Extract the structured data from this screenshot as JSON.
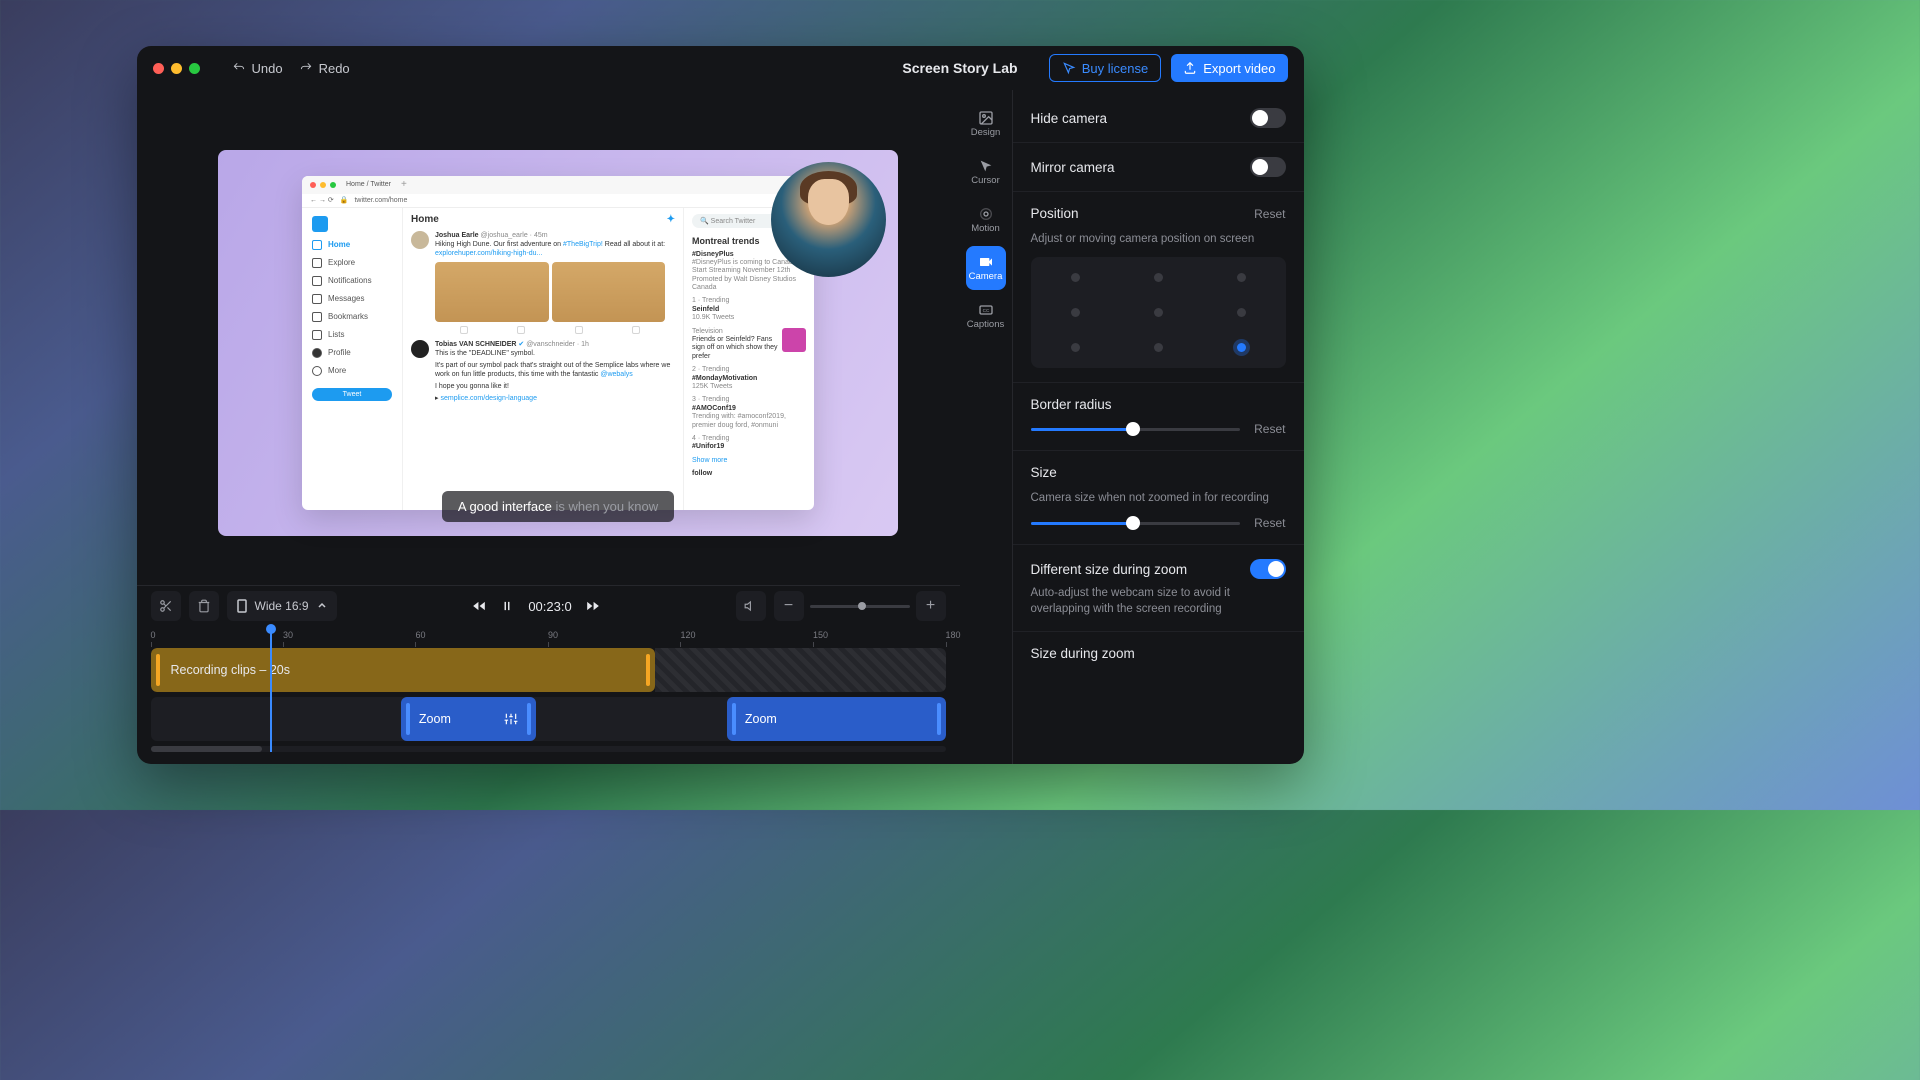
{
  "titlebar": {
    "undo": "Undo",
    "redo": "Redo",
    "title": "Screen Story Lab",
    "buy": "Buy license",
    "export": "Export video"
  },
  "stage": {
    "caption_strong": "A good interface",
    "caption_rest": " is when you know",
    "browser": {
      "tab": "Home / Twitter",
      "url": "twitter.com/home",
      "feed_title": "Home",
      "search": "Search Twitter",
      "nav": [
        "Home",
        "Explore",
        "Notifications",
        "Messages",
        "Bookmarks",
        "Lists",
        "Profile",
        "More"
      ],
      "tweet_btn": "Tweet",
      "tweet1": {
        "name": "Joshua Earle",
        "handle": "@joshua_earle · 45m",
        "text": "Hiking High Dune. Our first adventure on ",
        "hashtag": "#TheBigTrip!",
        "text2": " Read all about it at:",
        "link": "explorehuper.com/hiking-high-du..."
      },
      "tweet2": {
        "name": "Tobias VAN SCHNEIDER",
        "handle": " @vanschneider · 1h",
        "l1": "This is the \"DEADLINE\" symbol.",
        "l2": "It's part of our symbol pack that's straight out of the Semplice labs where we work on fun little products, this time with the fantastic ",
        "at": "@webalys",
        "l3": "I hope you gonna like it!",
        "link": "semplice.com/design-language"
      },
      "trends_title": "Montreal trends",
      "trends": [
        {
          "cat": "",
          "tag": "#DisneyPlus",
          "sub": "#DisneyPlus is coming to Canada. Start Streaming November 12th",
          "promo": "Promoted by Walt Disney Studios Canada"
        },
        {
          "cat": "1 · Trending",
          "tag": "Seinfeld",
          "sub": "10.9K Tweets"
        },
        {
          "cat": "Television",
          "tag": "Friends or Seinfeld? Fans sign off on which show they prefer"
        },
        {
          "cat": "2 · Trending",
          "tag": "#MondayMotivation",
          "sub": "125K Tweets"
        },
        {
          "cat": "3 · Trending",
          "tag": "#AMOConf19",
          "sub": "Trending with: #amoconf2019, premier doug ford, #onmuni"
        },
        {
          "cat": "4 · Trending",
          "tag": "#Unifor19"
        }
      ],
      "show_more": "Show more",
      "follow": "follow"
    }
  },
  "vtabs": [
    {
      "id": "design",
      "label": "Design"
    },
    {
      "id": "cursor",
      "label": "Cursor"
    },
    {
      "id": "motion",
      "label": "Motion"
    },
    {
      "id": "camera",
      "label": "Camera"
    },
    {
      "id": "captions",
      "label": "Captions"
    }
  ],
  "vtabs_active": "camera",
  "props": {
    "hide_camera": "Hide camera",
    "mirror_camera": "Mirror camera",
    "position": "Position",
    "position_sub": "Adjust or moving camera position on screen",
    "reset": "Reset",
    "border_radius": "Border radius",
    "size": "Size",
    "size_sub": "Camera size when not zoomed in for recording",
    "diff_zoom": "Different size during zoom",
    "diff_zoom_sub": "Auto-adjust the webcam size to avoid it overlapping with the screen recording",
    "size_during_zoom": "Size during zoom",
    "position_selected": 8,
    "br_pct": 49,
    "size_pct": 49
  },
  "timeline": {
    "ratio": "Wide 16:9",
    "time": "00:23:0",
    "ruler": [
      0,
      30,
      60,
      90,
      120,
      150,
      180
    ],
    "clip_label": "Recording clips – 20s",
    "zoom_label": "Zoom"
  }
}
